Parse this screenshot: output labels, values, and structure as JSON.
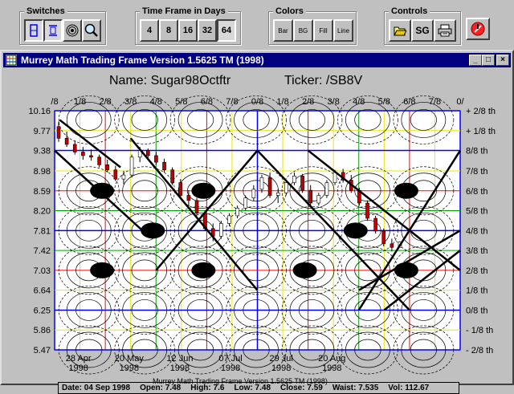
{
  "toolbar": {
    "switches": {
      "title": "Switches"
    },
    "timeframe": {
      "title": "Time Frame in Days",
      "options": [
        "4",
        "8",
        "16",
        "32",
        "64"
      ],
      "selected": "64"
    },
    "colors": {
      "title": "Colors",
      "buttons": [
        "Bar",
        "BG",
        "Fill",
        "Line"
      ]
    },
    "controls": {
      "title": "Controls",
      "sg_label": "SG"
    }
  },
  "window": {
    "title": "Murrey Math Trading Frame Version 1.5625  TM (1998)",
    "minimize": "_",
    "maximize": "□",
    "close": "×"
  },
  "chart": {
    "name_label": "Name: Sugar98Octftr",
    "ticker_label": "Ticker: /SB8V",
    "top_fractions": [
      "/8",
      "1/8",
      "2/8",
      "3/8",
      "4/8",
      "5/8",
      "6/8",
      "7/8",
      "0/8",
      "1/8",
      "2/8",
      "3/8",
      "4/8",
      "5/8",
      "6/8",
      "7/8",
      "0/"
    ],
    "left_prices": [
      "10.16",
      "9.77",
      "9.38",
      "8.98",
      "8.59",
      "8.20",
      "7.81",
      "7.42",
      "7.03",
      "6.64",
      "6.25",
      "5.86",
      "5.47"
    ],
    "right_levels": [
      "+ 2/8 th",
      "+ 1/8 th",
      "8/8 th",
      "7/8 th",
      "6/8 th",
      "5/8 th",
      "4/8 th",
      "3/8 th",
      "2/8 th",
      "1/8 th",
      "0/8 th",
      "- 1/8 th",
      "- 2/8 th"
    ],
    "date_labels": [
      {
        "day": "28 Apr",
        "year": "1998"
      },
      {
        "day": "20 May",
        "year": "1998"
      },
      {
        "day": "12 Jun",
        "year": "1998"
      },
      {
        "day": "07 Jul",
        "year": "1998"
      },
      {
        "day": "29 Jul",
        "year": "1998"
      },
      {
        "day": "20 Aug",
        "year": "1998"
      }
    ]
  },
  "status": {
    "date": "Date: 04 Sep 1998",
    "open": "Open: 7.48",
    "high": "High: 7.6",
    "low": "Low: 7.48",
    "close": "Close: 7.59",
    "waist": "Waist: 7.535",
    "vol": "Vol: 112.67"
  },
  "footer": "Murrey Math Trading Frame Version 1.5625  TM (1998)",
  "colors": {
    "title_bar": "#000080",
    "red_line": "#ff0000",
    "blue_line": "#0000ff",
    "green_line": "#00a000",
    "yellow_line": "#e8e800"
  },
  "chart_data": {
    "type": "table",
    "ylim": [
      5.47,
      10.16
    ],
    "price_levels": [
      10.16,
      9.77,
      9.38,
      8.98,
      8.59,
      8.2,
      7.81,
      7.42,
      7.03,
      6.64,
      6.25,
      5.86,
      5.47
    ],
    "ohlc_bars_approx": [
      [
        9.85,
        9.95,
        9.55,
        9.62
      ],
      [
        9.62,
        9.75,
        9.45,
        9.5
      ],
      [
        9.5,
        9.58,
        9.3,
        9.35
      ],
      [
        9.35,
        9.45,
        9.2,
        9.28
      ],
      [
        9.28,
        9.4,
        9.18,
        9.25
      ],
      [
        9.25,
        9.3,
        9.05,
        9.1
      ],
      [
        9.1,
        9.2,
        8.95,
        9.0
      ],
      [
        9.0,
        9.08,
        8.78,
        8.82
      ],
      [
        8.82,
        8.98,
        8.72,
        8.9
      ],
      [
        8.9,
        9.3,
        8.85,
        9.25
      ],
      [
        9.25,
        9.45,
        9.15,
        9.38
      ],
      [
        9.38,
        9.42,
        9.2,
        9.28
      ],
      [
        9.28,
        9.35,
        9.1,
        9.15
      ],
      [
        9.15,
        9.22,
        8.95,
        9.0
      ],
      [
        9.0,
        9.05,
        8.7,
        8.75
      ],
      [
        8.75,
        8.82,
        8.45,
        8.5
      ],
      [
        8.5,
        8.6,
        8.3,
        8.4
      ],
      [
        8.4,
        8.45,
        8.1,
        8.15
      ],
      [
        8.15,
        8.2,
        7.8,
        7.85
      ],
      [
        7.85,
        7.95,
        7.6,
        7.7
      ],
      [
        7.7,
        8.0,
        7.65,
        7.95
      ],
      [
        7.95,
        8.15,
        7.9,
        8.1
      ],
      [
        8.1,
        8.3,
        8.05,
        8.25
      ],
      [
        8.25,
        8.5,
        8.2,
        8.45
      ],
      [
        8.45,
        8.7,
        8.4,
        8.62
      ],
      [
        8.62,
        8.9,
        8.55,
        8.85
      ],
      [
        8.85,
        8.95,
        8.45,
        8.5
      ],
      [
        8.5,
        8.62,
        8.35,
        8.55
      ],
      [
        8.55,
        8.8,
        8.5,
        8.75
      ],
      [
        8.75,
        8.95,
        8.7,
        8.88
      ],
      [
        8.88,
        8.92,
        8.55,
        8.6
      ],
      [
        8.6,
        8.7,
        8.3,
        8.35
      ],
      [
        8.35,
        8.55,
        8.3,
        8.5
      ],
      [
        8.5,
        8.8,
        8.45,
        8.75
      ],
      [
        8.75,
        9.0,
        8.7,
        8.95
      ],
      [
        8.95,
        9.02,
        8.75,
        8.8
      ],
      [
        8.8,
        8.9,
        8.55,
        8.6
      ],
      [
        8.6,
        8.65,
        8.3,
        8.35
      ],
      [
        8.35,
        8.4,
        8.0,
        8.05
      ],
      [
        8.05,
        8.1,
        7.75,
        7.8
      ],
      [
        7.8,
        7.85,
        7.5,
        7.55
      ],
      [
        7.55,
        7.65,
        7.4,
        7.48
      ],
      [
        7.48,
        7.6,
        7.48,
        7.59
      ]
    ]
  }
}
